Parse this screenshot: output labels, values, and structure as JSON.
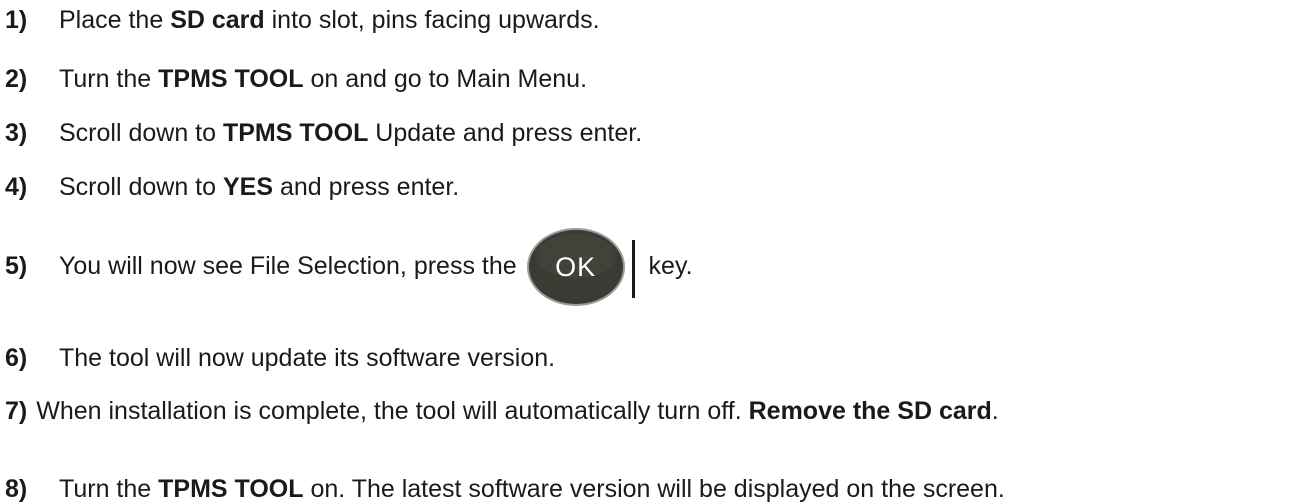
{
  "steps": [
    {
      "num": "1)",
      "pre": "Place the ",
      "bold": "SD card",
      "post": " into slot, pins facing upwards."
    },
    {
      "num": "2)",
      "pre": "Turn the ",
      "bold": "TPMS TOOL",
      "post": " on and go to Main Menu."
    },
    {
      "num": "3)",
      "pre": "Scroll down to ",
      "bold": "TPMS TOOL",
      "post": " Update and press enter."
    },
    {
      "num": "4)",
      "pre": "Scroll down to ",
      "bold": "YES",
      "post": " and press enter."
    },
    {
      "num": "5)",
      "pre": "You will now see File Selection, press the ",
      "key_label": "OK",
      "post": " key."
    },
    {
      "num": "6)",
      "text": "The tool will now update its software version."
    },
    {
      "num": "7)",
      "pre": "When installation is complete, the tool will automatically turn off. ",
      "bold": "Remove the SD card",
      "post": "."
    },
    {
      "num": "8)",
      "pre": "Turn the ",
      "bold": "TPMS TOOL",
      "post": " on. The latest software version will be displayed on the screen."
    }
  ],
  "colors": {
    "text": "#1a1a1a",
    "key_body": "#3b3a33",
    "key_rim": "#8a8a8a",
    "key_label": "#ffffff"
  },
  "icons": {
    "ok_key": "ok-key-icon"
  }
}
